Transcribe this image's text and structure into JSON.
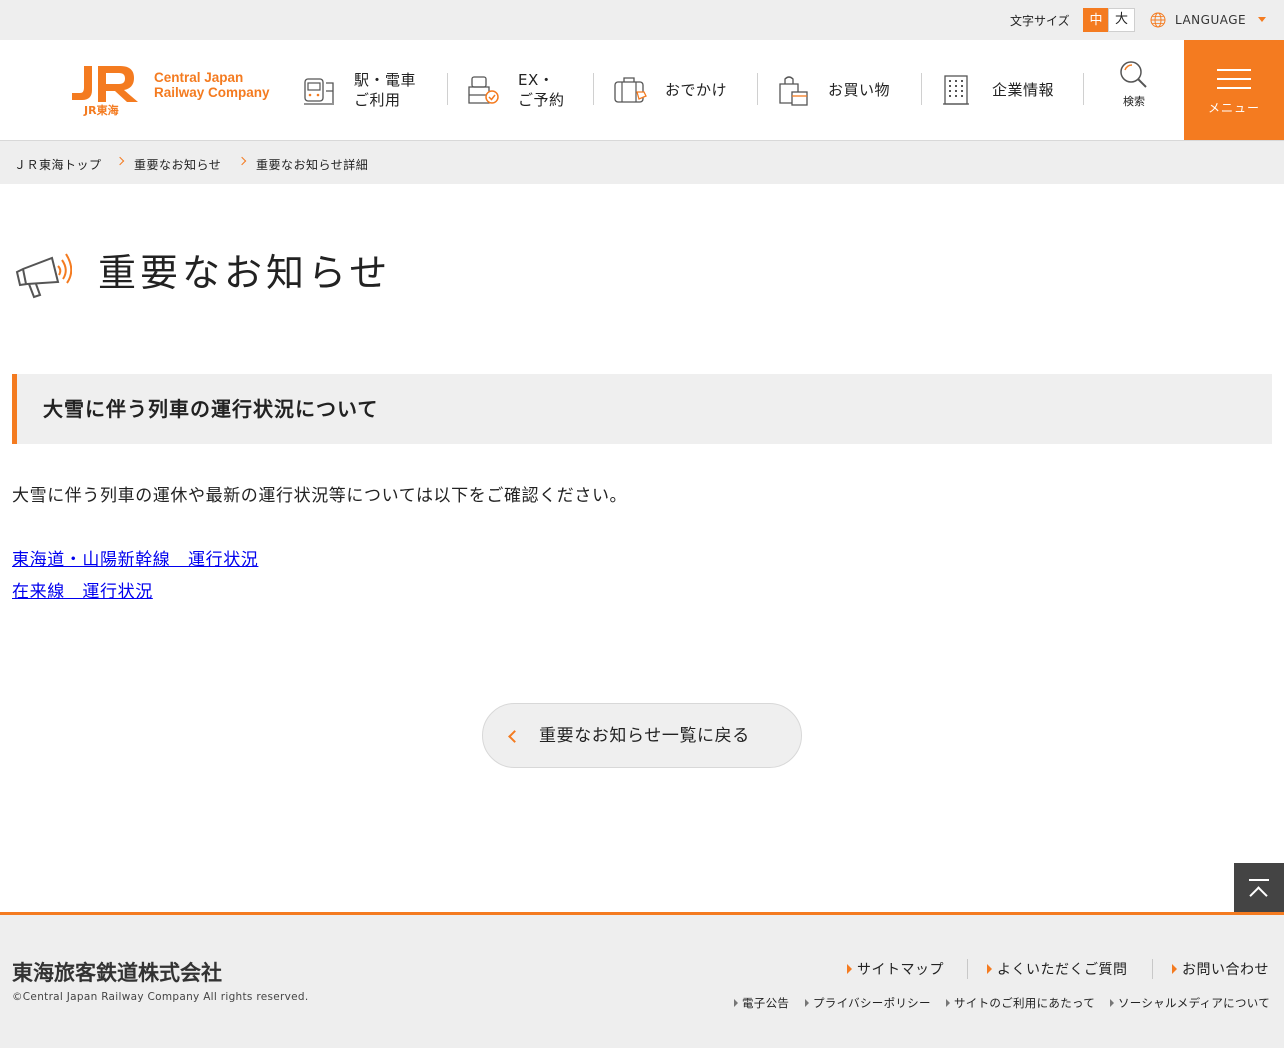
{
  "utility": {
    "font_size_label": "文字サイズ",
    "font_size_mid": "中",
    "font_size_large": "大",
    "language": "LANGUAGE"
  },
  "header": {
    "logo_text_line1": "Central Japan",
    "logo_text_line2": "Railway Company",
    "logo_mark_sub": "JR東海",
    "nav": [
      {
        "line1": "駅・電車",
        "line2": "ご利用",
        "icon": "train-station-icon"
      },
      {
        "line1": "EX・",
        "line2": "ご予約",
        "icon": "reservation-icon"
      },
      {
        "line1": "おでかけ",
        "line2": "",
        "icon": "suitcase-icon"
      },
      {
        "line1": "お買い物",
        "line2": "",
        "icon": "shopping-bag-icon"
      },
      {
        "line1": "企業情報",
        "line2": "",
        "icon": "building-icon"
      }
    ],
    "search_label": "検索",
    "menu_label": "メニュー"
  },
  "breadcrumb": [
    "ＪＲ東海トップ",
    "重要なお知らせ",
    "重要なお知らせ詳細"
  ],
  "page_title": "重要なお知らせ",
  "article": {
    "heading": "大雪に伴う列車の運行状況について",
    "body": "大雪に伴う列車の運休や最新の運行状況等については以下をご確認ください。",
    "links": [
      "東海道・山陽新幹線　運行状況",
      "在来線　運行状況"
    ]
  },
  "back_button": "重要なお知らせ一覧に戻る",
  "footer": {
    "company": "東海旅客鉄道株式会社",
    "copyright": "©Central Japan Railway Company All rights reserved.",
    "primary_links": [
      "サイトマップ",
      "よくいただくご質問",
      "お問い合わせ"
    ],
    "secondary_links": [
      "電子公告",
      "プライバシーポリシー",
      "サイトのご利用にあたって",
      "ソーシャルメディアについて"
    ]
  },
  "colors": {
    "accent": "#f47b20",
    "gray_bg": "#eeeeee",
    "link": "#0000ee"
  }
}
